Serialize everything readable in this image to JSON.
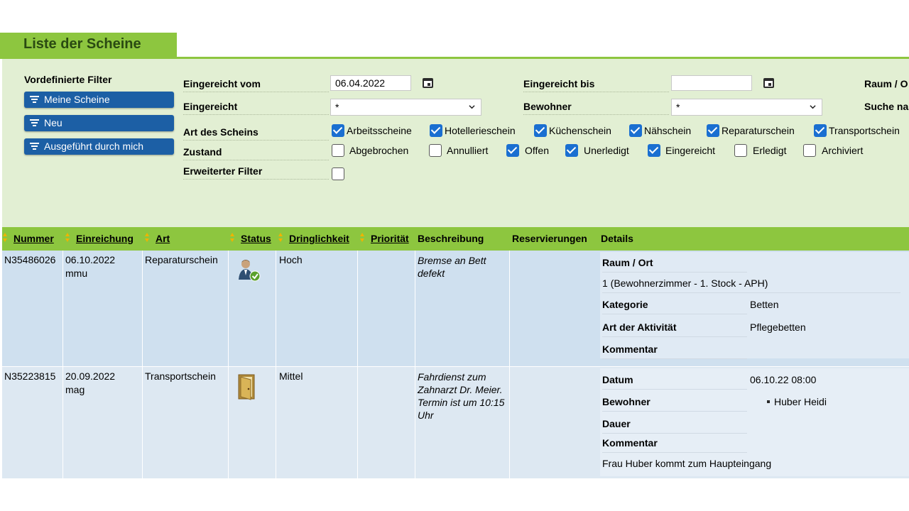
{
  "page": {
    "title": "Liste der Scheine"
  },
  "prefilters": {
    "title": "Vordefinierte Filter",
    "buttons": [
      "Meine Scheine",
      "Neu",
      "Ausgeführt durch mich"
    ]
  },
  "filters": {
    "eingereicht_vom": {
      "label": "Eingereicht vom",
      "value": "06.04.2022"
    },
    "eingereicht_bis": {
      "label": "Eingereicht bis",
      "value": ""
    },
    "raum": {
      "label": "Raum / O"
    },
    "eingereicht": {
      "label": "Eingereicht",
      "value": "*"
    },
    "bewohner": {
      "label": "Bewohner",
      "value": "*"
    },
    "suche": {
      "label": "Suche na"
    },
    "art": {
      "label": "Art des Scheins",
      "options": [
        {
          "label": "Arbeitsscheine",
          "checked": true
        },
        {
          "label": "Hotellerieschein",
          "checked": true
        },
        {
          "label": "Küchenschein",
          "checked": true
        },
        {
          "label": "Nähschein",
          "checked": true
        },
        {
          "label": "Reparaturschein",
          "checked": true
        },
        {
          "label": "Transportschein",
          "checked": true
        }
      ]
    },
    "zustand": {
      "label": "Zustand",
      "options": [
        {
          "label": "Abgebrochen",
          "checked": false
        },
        {
          "label": "Annulliert",
          "checked": false
        },
        {
          "label": "Offen",
          "checked": true
        },
        {
          "label": "Unerledigt",
          "checked": true
        },
        {
          "label": "Eingereicht",
          "checked": true
        },
        {
          "label": "Erledigt",
          "checked": false
        },
        {
          "label": "Archiviert",
          "checked": false
        }
      ]
    },
    "erweitert": {
      "label": "Erweiterter Filter",
      "checked": false
    }
  },
  "table": {
    "columns": [
      "Nummer",
      "Einreichung",
      "Art",
      "Status",
      "Dringlichkeit",
      "Priorität",
      "Beschreibung",
      "Reservierungen",
      "Details"
    ],
    "rows": [
      {
        "nummer": "N35486026",
        "datum": "06.10.2022",
        "user": "mmu",
        "art": "Reparaturschein",
        "status_icon": "person-check-icon",
        "dringlichkeit": "Hoch",
        "prioritaet": "",
        "beschreibung": "Bremse an Bett defekt",
        "reservierungen": "",
        "details": {
          "raum_label": "Raum / Ort",
          "raum_value": "1 (Bewohnerzimmer - 1. Stock - APH)",
          "kategorie_label": "Kategorie",
          "kategorie_value": "Betten",
          "aktivitaet_label": "Art der Aktivität",
          "aktivitaet_value": "Pflegebetten",
          "kommentar_label": "Kommentar",
          "kommentar_value": ""
        }
      },
      {
        "nummer": "N35223815",
        "datum": "20.09.2022",
        "user": "mag",
        "art": "Transportschein",
        "status_icon": "open-door-icon",
        "dringlichkeit": "Mittel",
        "prioritaet": "",
        "beschreibung": "Fahrdienst zum Zahnarzt Dr. Meier. Termin ist um 10:15 Uhr",
        "reservierungen": "",
        "details": {
          "datum_label": "Datum",
          "datum_value": "06.10.22 08:00",
          "bewohner_label": "Bewohner",
          "bewohner_value": "Huber Heidi",
          "dauer_label": "Dauer",
          "dauer_value": "",
          "kommentar_label": "Kommentar",
          "kommentar_value": "Frau Huber kommt zum Haupteingang"
        }
      }
    ]
  },
  "colors": {
    "header_green": "#8dc63f",
    "filter_bg": "#e2efd3",
    "button_blue": "#1c5fa5",
    "checkbox_blue": "#1a6fd1",
    "row_bg": "#cfe0ef",
    "sort_icon": "#f0b400"
  }
}
